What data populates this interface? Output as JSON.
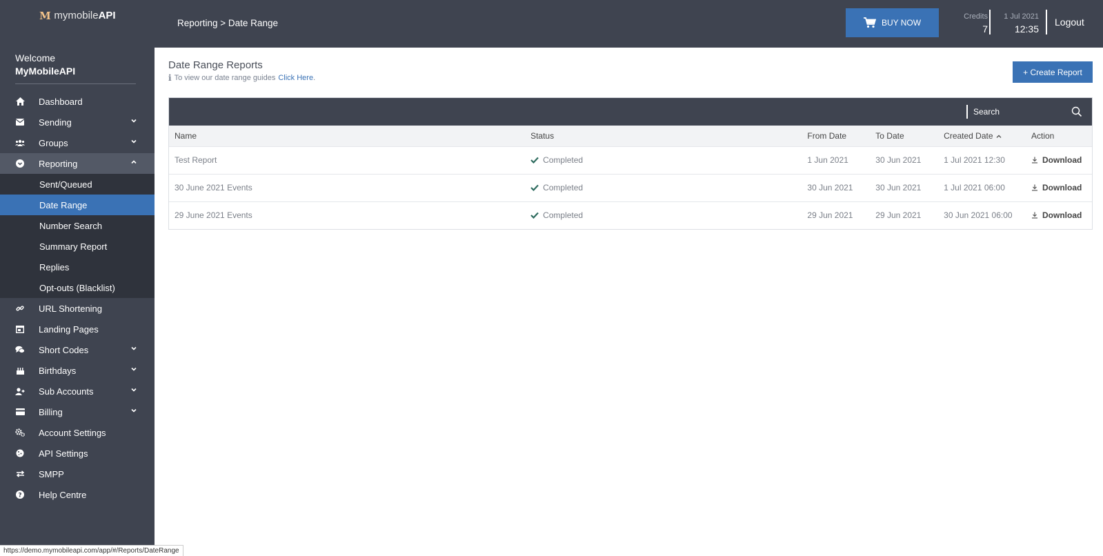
{
  "logo": {
    "text_light": "mymobile",
    "text_bold": "API",
    "mark": "M"
  },
  "welcome": {
    "greeting": "Welcome",
    "user": "MyMobileAPI"
  },
  "sidebar": {
    "items": [
      {
        "label": "Dashboard",
        "icon": "home-icon"
      },
      {
        "label": "Sending",
        "icon": "envelope-icon"
      },
      {
        "label": "Groups",
        "icon": "users-icon"
      },
      {
        "label": "Reporting",
        "icon": "chevron-circle-icon"
      },
      {
        "label": "URL Shortening",
        "icon": "link-icon"
      },
      {
        "label": "Landing Pages",
        "icon": "window-icon"
      },
      {
        "label": "Short Codes",
        "icon": "chat-icon"
      },
      {
        "label": "Birthdays",
        "icon": "cake-icon"
      },
      {
        "label": "Sub Accounts",
        "icon": "user-plus-icon"
      },
      {
        "label": "Billing",
        "icon": "credit-card-icon"
      },
      {
        "label": "Account Settings",
        "icon": "gears-icon"
      },
      {
        "label": "API Settings",
        "icon": "cookie-icon"
      },
      {
        "label": "SMPP",
        "icon": "exchange-icon"
      },
      {
        "label": "Help Centre",
        "icon": "help-icon"
      }
    ],
    "reporting_sub": [
      {
        "label": "Sent/Queued"
      },
      {
        "label": "Date Range"
      },
      {
        "label": "Number Search"
      },
      {
        "label": "Summary Report"
      },
      {
        "label": "Replies"
      },
      {
        "label": "Opt-outs (Blacklist)"
      }
    ]
  },
  "topbar": {
    "breadcrumb": "Reporting > Date Range",
    "buy_label": "BUY NOW",
    "credits_label": "Credits",
    "credits_value": "7",
    "date": "1 Jul 2021",
    "time": "12:35",
    "logout": "Logout"
  },
  "page": {
    "title": "Date Range Reports",
    "guide_text": "To view our date range guides",
    "guide_link": "Click Here",
    "guide_end": ".",
    "create_label": "+ Create Report"
  },
  "search": {
    "placeholder": "Search"
  },
  "table": {
    "headers": {
      "name": "Name",
      "status": "Status",
      "from": "From Date",
      "to": "To Date",
      "created": "Created Date",
      "action": "Action"
    },
    "download_label": "Download",
    "rows": [
      {
        "name": "Test Report",
        "status": "Completed",
        "from": "1 Jun 2021",
        "to": "30 Jun 2021",
        "created": "1 Jul 2021 12:30"
      },
      {
        "name": "30 June 2021 Events",
        "status": "Completed",
        "from": "30 Jun 2021",
        "to": "30 Jun 2021",
        "created": "1 Jul 2021 06:00"
      },
      {
        "name": "29 June 2021 Events",
        "status": "Completed",
        "from": "29 Jun 2021",
        "to": "29 Jun 2021",
        "created": "30 Jun 2021 06:00"
      }
    ]
  },
  "status_url": "https://demo.mymobileapi.com/app/#/Reports/DateRange",
  "colors": {
    "sidebar": "#3f4450",
    "accent": "#3a72b5",
    "submenu": "#2f333c",
    "check": "#2d6b5e"
  }
}
